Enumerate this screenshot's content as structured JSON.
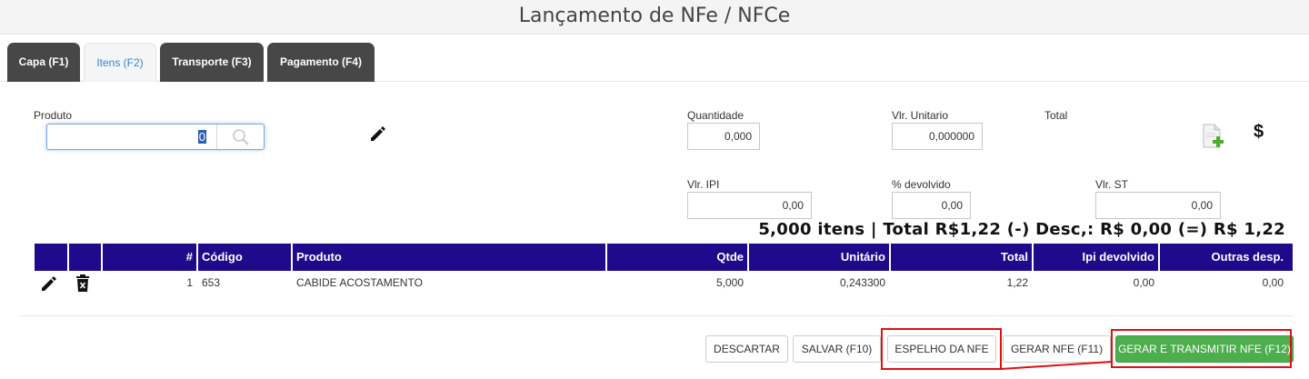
{
  "header": {
    "title": "Lançamento de NFe / NFCe"
  },
  "tabs": [
    {
      "label": "Capa (F1)"
    },
    {
      "label": "Itens (F2)"
    },
    {
      "label": "Transporte (F3)"
    },
    {
      "label": "Pagamento (F4)"
    }
  ],
  "form": {
    "produto_label": "Produto",
    "produto_value": "0",
    "quantidade_label": "Quantidade",
    "quantidade_value": "0,000",
    "vlr_unitario_label": "Vlr. Unitario",
    "vlr_unitario_value": "0,000000",
    "total_label": "Total",
    "vlr_ipi_label": "Vlr. IPI",
    "vlr_ipi_value": "0,00",
    "devolvido_label": "% devolvido",
    "devolvido_value": "0,00",
    "vlr_st_label": "Vlr. ST",
    "vlr_st_value": "0,00",
    "dollar_symbol": "$"
  },
  "summary": "5,000 itens | Total R$1,22 (-) Desc,: R$ 0,00 (=) R$ 1,22",
  "table": {
    "headers": [
      "#",
      "Código",
      "Produto",
      "Qtde",
      "Unitário",
      "Total",
      "Ipi devolvido",
      "Outras desp."
    ],
    "rows": [
      {
        "num": "1",
        "codigo": "653",
        "produto": "CABIDE ACOSTAMENTO",
        "qtde": "5,000",
        "unitario": "0,243300",
        "total": "1,22",
        "ipi_devolvido": "0,00",
        "outras_desp": "0,00"
      }
    ]
  },
  "actions": {
    "descartar": "DESCARTAR",
    "salvar": "SALVAR (F10)",
    "espelho": "ESPELHO DA NFE",
    "gerar": "GERAR NFE (F11)",
    "gerar_transmitir": "GERAR E TRANSMITIR NFE (F12)"
  },
  "colors": {
    "table_header": "#1f0a8c",
    "primary_green": "#4cae4c",
    "highlight_red": "#e01010",
    "tab_dark": "#474747"
  }
}
